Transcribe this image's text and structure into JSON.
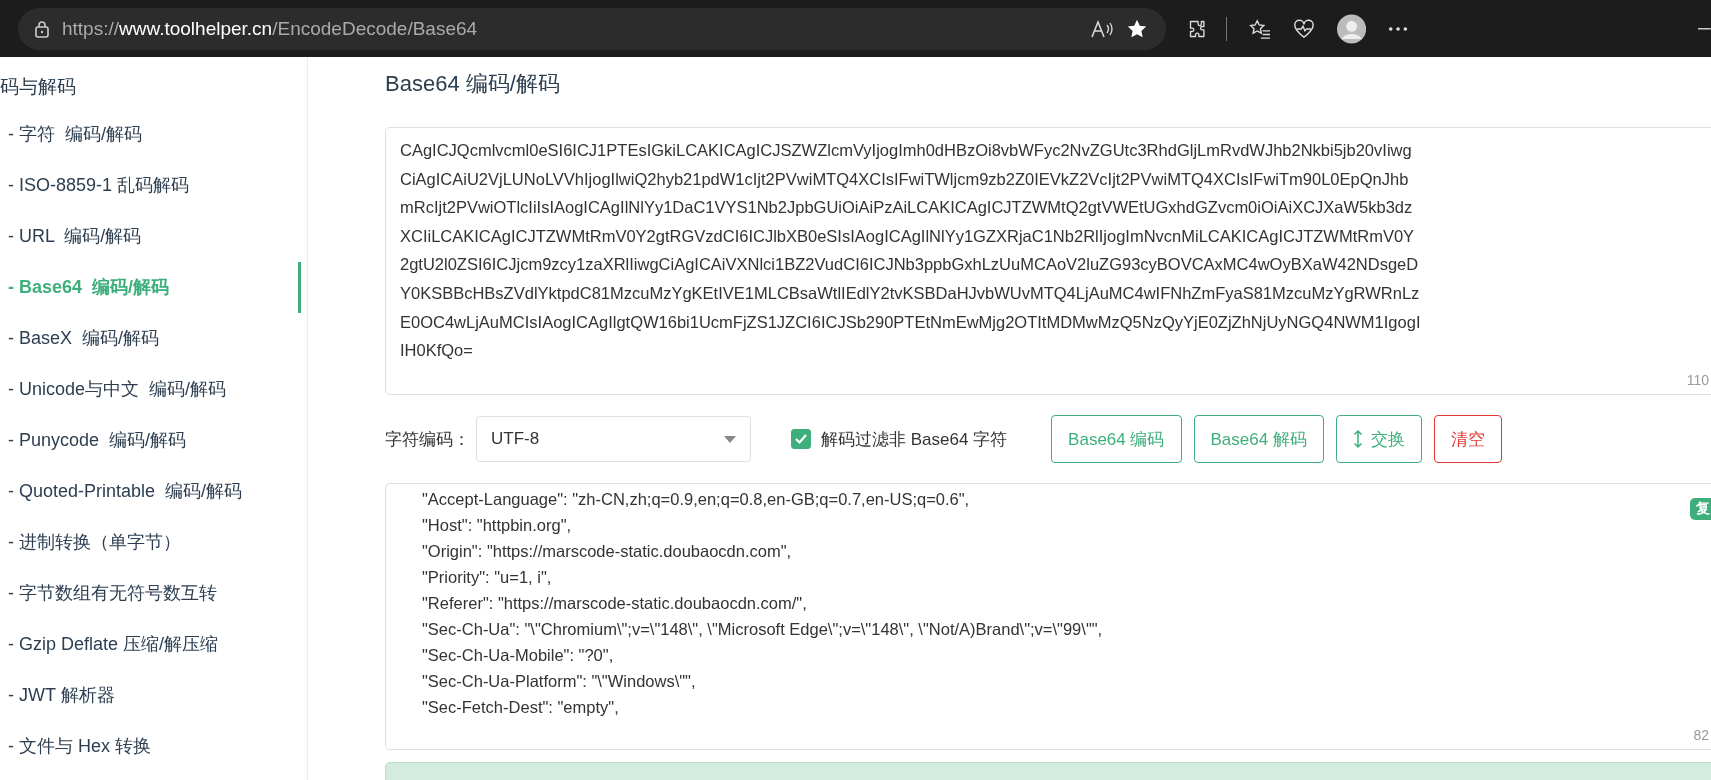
{
  "browser": {
    "url": {
      "scheme": "https://",
      "host": "www.toolhelper.cn",
      "path": "/EncodeDecode/Base64"
    }
  },
  "sidebar": {
    "heading": "码与解码",
    "items": [
      {
        "label": "- 字符  编码/解码",
        "selected": false
      },
      {
        "label": "- ISO-8859-1 乱码解码",
        "selected": false
      },
      {
        "label": "- URL  编码/解码",
        "selected": false
      },
      {
        "label": "- Base64  编码/解码",
        "selected": true
      },
      {
        "label": "- BaseX  编码/解码",
        "selected": false
      },
      {
        "label": "- Unicode与中文  编码/解码",
        "selected": false
      },
      {
        "label": "- Punycode  编码/解码",
        "selected": false
      },
      {
        "label": "- Quoted-Printable  编码/解码",
        "selected": false
      },
      {
        "label": "- 进制转换（单字节）",
        "selected": false
      },
      {
        "label": "- 字节数组有无符号数互转",
        "selected": false
      },
      {
        "label": "- Gzip Deflate 压缩/解压缩",
        "selected": false
      },
      {
        "label": "- JWT 解析器",
        "selected": false
      },
      {
        "label": "- 文件与 Hex 转换",
        "selected": false
      }
    ]
  },
  "title": "Base64 编码/解码",
  "input": {
    "lines": [
      "CAgICJQcmlvcml0eSI6ICJ1PTEsIGkiLCAKICAgICJSZWZlcmVyIjogImh0dHBzOi8vbWFyc2NvZGUtc3RhdGljLmRvdWJhb2Nkbi5jb20vIiwg",
      "CiAgICAiU2VjLUNoLVVhIjogIlwiQ2hyb21pdW1cIjt2PVwiMTQ4XCIsIFwiTWljcm9zb2Z0IEVkZ2VcIjt2PVwiMTQ4XCIsIFwiTm90L0EpQnJhb",
      "mRcIjt2PVwiOTlcIiIsIAogICAgIlNlYy1DaC1VYS1Nb2JpbGUiOiAiPzAiLCAKICAgICJTZWMtQ2gtVWEtUGxhdGZvcm0iOiAiXCJXaW5kb3dz",
      "XCIiLCAKICAgICJTZWMtRmV0Y2gtRGVzdCI6ICJlbXB0eSIsIAogICAgIlNlYy1GZXRjaC1Nb2RlIjogImNvcnMiLCAKICAgICJTZWMtRmV0Y",
      "2gtU2l0ZSI6ICJjcm9zcy1zaXRlIiwgCiAgICAiVXNlci1BZ2VudCI6ICJNb3ppbGxhLzUuMCAoV2luZG93cyBOVCAxMC4wOyBXaW42NDsgeD",
      "Y0KSBBcHBsZVdlYktpdC81MzcuMzYgKEtIVE1MLCBsaWtlIEdlY2tvKSBDaHJvbWUvMTQ4LjAuMC4wIFNhZmFyaS81MzcuMzYgRWRnLz",
      "E0OC4wLjAuMCIsIAogICAgIlgtQW16bi1UcmFjZS1JZCI6ICJSb290PTEtNmEwMjg2OTItMDMwMzQ5NzQyYjE0ZjZhNjUyNGQ4NWM1IgogI",
      "IH0KfQo="
    ],
    "count": "110"
  },
  "controls": {
    "encoding_label": "字符编码：",
    "encoding": "UTF-8",
    "filter": {
      "label": "解码过滤非 Base64 字符",
      "checked": true
    },
    "buttons": [
      {
        "kind": "primary",
        "label": "Base64 编码"
      },
      {
        "kind": "primary",
        "label": "Base64 解码"
      },
      {
        "kind": "swap",
        "label": "交换"
      },
      {
        "kind": "danger",
        "label": "清空"
      }
    ]
  },
  "output": {
    "lines": [
      "\"Accept-Language\": \"zh-CN,zh;q=0.9,en;q=0.8,en-GB;q=0.7,en-US;q=0.6\",",
      "\"Host\": \"httpbin.org\",",
      "\"Origin\": \"https://marscode-static.doubaocdn.com\",",
      "\"Priority\": \"u=1, i\",",
      "\"Referer\": \"https://marscode-static.doubaocdn.com/\",",
      "\"Sec-Ch-Ua\": \"\\\"Chromium\\\";v=\\\"148\\\", \\\"Microsoft Edge\\\";v=\\\"148\\\", \\\"Not/A)Brand\\\";v=\\\"99\\\"\",",
      "\"Sec-Ch-Ua-Mobile\": \"?0\",",
      "\"Sec-Ch-Ua-Platform\": \"\\\"Windows\\\"\",",
      "\"Sec-Fetch-Dest\": \"empty\","
    ],
    "copy": "复",
    "count": "82"
  }
}
